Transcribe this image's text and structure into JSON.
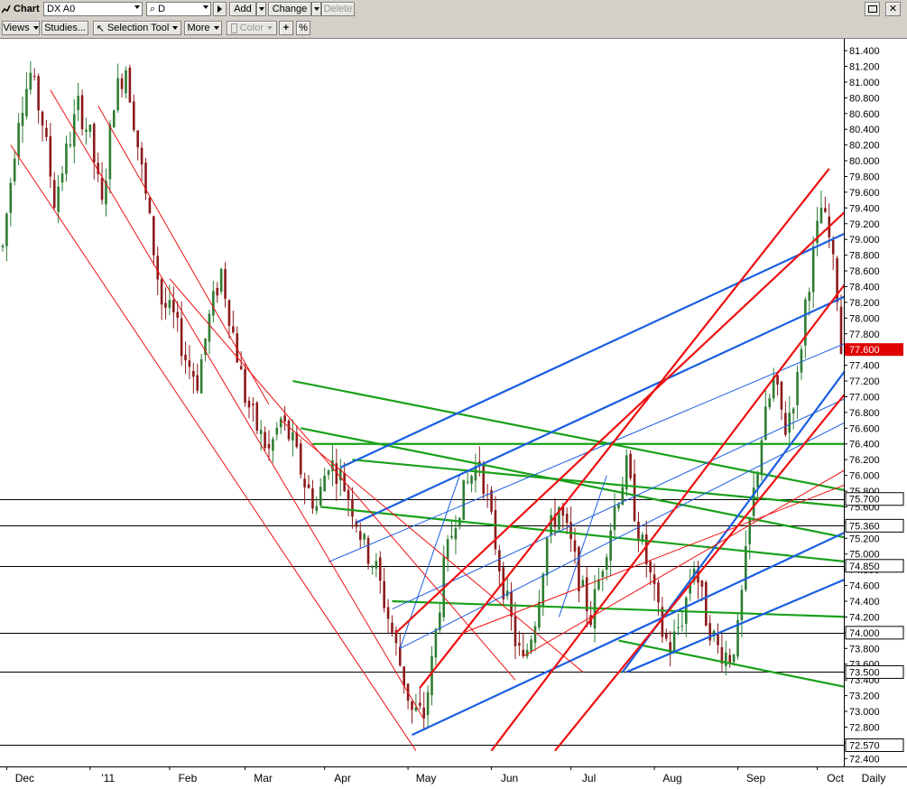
{
  "toolbar": {
    "chart_label": "Chart",
    "symbol_value": "DX A0",
    "period_value": "D",
    "add_label": "Add",
    "change_label": "Change",
    "delete_label": "Delete",
    "views_label": "Views",
    "studies_label": "Studies...",
    "selection_tool_label": "Selection Tool",
    "more_label": "More",
    "color_label": "Color",
    "crosshair_label": "+",
    "percent_label": "%"
  },
  "colors": {
    "up_candle": "#2e7d32",
    "down_candle": "#8b1a1a",
    "price_badge": "#e00000",
    "red_channel": "#ee1111",
    "blue_channel": "#1a5fe0",
    "green_channel": "#1aa01a",
    "black_level": "#000000"
  },
  "chart_data": {
    "type": "candlestick",
    "symbol": "DX A0",
    "interval": "Daily",
    "ylim": [
      72.3,
      81.55
    ],
    "y_ticks": [
      81.4,
      81.2,
      81.0,
      80.8,
      80.6,
      80.4,
      80.2,
      80.0,
      79.8,
      79.6,
      79.4,
      79.2,
      79.0,
      78.8,
      78.6,
      78.4,
      78.2,
      78.0,
      77.8,
      77.6,
      77.4,
      77.2,
      77.0,
      76.8,
      76.6,
      76.4,
      76.2,
      76.0,
      75.8,
      75.6,
      75.4,
      75.2,
      75.0,
      74.8,
      74.6,
      74.4,
      74.2,
      74.0,
      73.8,
      73.6,
      73.4,
      73.2,
      73.0,
      72.8,
      72.6,
      72.4
    ],
    "y_tick_labels": [
      "81.400",
      "81.200",
      "81.000",
      "80.800",
      "80.600",
      "80.400",
      "80.200",
      "80.000",
      "79.800",
      "79.600",
      "79.400",
      "79.200",
      "79.000",
      "78.800",
      "78.600",
      "78.400",
      "78.200",
      "78.000",
      "77.800",
      "77.600",
      "77.400",
      "77.200",
      "77.000",
      "76.800",
      "76.600",
      "76.400",
      "76.200",
      "76.000",
      "75.800",
      "75.600",
      "75.400",
      "75.200",
      "75.000",
      "74.800",
      "74.600",
      "74.400",
      "74.200",
      "74.000",
      "73.800",
      "73.600",
      "73.400",
      "73.200",
      "73.000",
      "72.800",
      "72.600",
      "72.400"
    ],
    "x_labels": [
      "Dec",
      "'11",
      "Feb",
      "Mar",
      "Apr",
      "May",
      "Jun",
      "Jul",
      "Aug",
      "Sep",
      "Oct"
    ],
    "x_label_positions": [
      1,
      22,
      42,
      61,
      81,
      102,
      123,
      143,
      164,
      185,
      205
    ],
    "num_bars": 212,
    "level_lines": [
      {
        "price": 75.7,
        "label": "75.700"
      },
      {
        "price": 75.36,
        "label": "75.360"
      },
      {
        "price": 74.85,
        "label": "74.850"
      },
      {
        "price": 74.0,
        "label": "74.000"
      },
      {
        "price": 73.5,
        "label": "73.500"
      },
      {
        "price": 72.57,
        "label": "72.570"
      }
    ],
    "last_price": 77.6,
    "last_price_label": "77.600",
    "close_path": [
      [
        0,
        78.9
      ],
      [
        4,
        80.6
      ],
      [
        7,
        81.1
      ],
      [
        10,
        80.5
      ],
      [
        13,
        79.5
      ],
      [
        16,
        80.1
      ],
      [
        19,
        80.7
      ],
      [
        22,
        80.3
      ],
      [
        25,
        79.4
      ],
      [
        28,
        80.8
      ],
      [
        31,
        81.2
      ],
      [
        34,
        80.2
      ],
      [
        37,
        79.2
      ],
      [
        40,
        78.2
      ],
      [
        43,
        78.0
      ],
      [
        46,
        77.5
      ],
      [
        49,
        77.2
      ],
      [
        52,
        78.0
      ],
      [
        55,
        78.6
      ],
      [
        58,
        77.8
      ],
      [
        61,
        77.0
      ],
      [
        64,
        76.6
      ],
      [
        67,
        76.3
      ],
      [
        70,
        76.7
      ],
      [
        73,
        76.4
      ],
      [
        76,
        75.9
      ],
      [
        79,
        75.6
      ],
      [
        82,
        76.2
      ],
      [
        85,
        76.0
      ],
      [
        88,
        75.6
      ],
      [
        91,
        75.1
      ],
      [
        94,
        74.8
      ],
      [
        97,
        74.2
      ],
      [
        100,
        73.6
      ],
      [
        103,
        73.0
      ],
      [
        106,
        72.95
      ],
      [
        108,
        73.6
      ],
      [
        111,
        74.8
      ],
      [
        114,
        75.5
      ],
      [
        117,
        75.9
      ],
      [
        120,
        76.2
      ],
      [
        123,
        75.4
      ],
      [
        126,
        74.6
      ],
      [
        129,
        73.9
      ],
      [
        131,
        73.6
      ],
      [
        134,
        74.2
      ],
      [
        137,
        75.2
      ],
      [
        140,
        75.6
      ],
      [
        143,
        75.1
      ],
      [
        146,
        74.5
      ],
      [
        148,
        74.2
      ],
      [
        151,
        74.9
      ],
      [
        154,
        75.6
      ],
      [
        157,
        76.1
      ],
      [
        160,
        75.3
      ],
      [
        163,
        74.7
      ],
      [
        166,
        74.0
      ],
      [
        168,
        73.8
      ],
      [
        171,
        74.2
      ],
      [
        174,
        74.9
      ],
      [
        177,
        74.2
      ],
      [
        180,
        73.8
      ],
      [
        183,
        73.7
      ],
      [
        185,
        74.0
      ],
      [
        188,
        75.4
      ],
      [
        191,
        76.5
      ],
      [
        194,
        77.2
      ],
      [
        197,
        76.6
      ],
      [
        200,
        77.2
      ],
      [
        202,
        78.2
      ],
      [
        204,
        78.8
      ],
      [
        206,
        79.4
      ],
      [
        208,
        79.0
      ],
      [
        210,
        78.3
      ],
      [
        211,
        77.6
      ]
    ],
    "drawn_lines": {
      "red": [
        {
          "p1": [
            2,
            80.2
          ],
          "p2": [
            104,
            72.5
          ],
          "w": 1
        },
        {
          "p1": [
            24,
            80.7
          ],
          "p2": [
            67,
            76.9
          ],
          "w": 1
        },
        {
          "p1": [
            12,
            80.9
          ],
          "p2": [
            106,
            72.9
          ],
          "w": 1
        },
        {
          "p1": [
            42,
            78.5
          ],
          "p2": [
            129,
            73.4
          ],
          "w": 1
        },
        {
          "p1": [
            70,
            76.7
          ],
          "p2": [
            146,
            73.5
          ],
          "w": 1
        },
        {
          "p1": [
            99,
            74.0
          ],
          "p2": [
            213,
            79.4
          ],
          "w": 2
        },
        {
          "p1": [
            123,
            72.5
          ],
          "p2": [
            213,
            78.5
          ],
          "w": 2
        },
        {
          "p1": [
            139,
            72.5
          ],
          "p2": [
            213,
            77.1
          ],
          "w": 2
        },
        {
          "p1": [
            105,
            73.3
          ],
          "p2": [
            208,
            79.9
          ],
          "w": 2
        },
        {
          "p1": [
            116,
            74.0
          ],
          "p2": [
            213,
            75.9
          ],
          "w": 1
        },
        {
          "p1": [
            131,
            73.7
          ],
          "p2": [
            213,
            76.1
          ],
          "w": 1
        }
      ],
      "blue": [
        {
          "p1": [
            85,
            76.1
          ],
          "p2": [
            213,
            79.1
          ],
          "w": 2
        },
        {
          "p1": [
            103,
            72.7
          ],
          "p2": [
            213,
            75.3
          ],
          "w": 2
        },
        {
          "p1": [
            89,
            75.4
          ],
          "p2": [
            213,
            78.3
          ],
          "w": 2
        },
        {
          "p1": [
            157,
            73.5
          ],
          "p2": [
            213,
            74.7
          ],
          "w": 2
        },
        {
          "p1": [
            156,
            73.5
          ],
          "p2": [
            213,
            77.4
          ],
          "w": 2
        },
        {
          "p1": [
            82,
            74.9
          ],
          "p2": [
            213,
            77.7
          ],
          "w": 1
        },
        {
          "p1": [
            98,
            74.3
          ],
          "p2": [
            213,
            77.0
          ],
          "w": 1
        },
        {
          "p1": [
            100,
            73.8
          ],
          "p2": [
            213,
            76.7
          ],
          "w": 1
        },
        {
          "p1": [
            100,
            73.8
          ],
          "p2": [
            115,
            76.0
          ],
          "w": 1
        },
        {
          "p1": [
            140,
            74.2
          ],
          "p2": [
            152,
            76.0
          ],
          "w": 1
        }
      ],
      "green": [
        {
          "p1": [
            73,
            77.2
          ],
          "p2": [
            213,
            75.8
          ],
          "w": 2
        },
        {
          "p1": [
            75,
            76.6
          ],
          "p2": [
            213,
            75.2
          ],
          "w": 2
        },
        {
          "p1": [
            80,
            75.6
          ],
          "p2": [
            213,
            74.9
          ],
          "w": 2
        },
        {
          "p1": [
            88,
            76.2
          ],
          "p2": [
            213,
            75.6
          ],
          "w": 2
        },
        {
          "p1": [
            98,
            74.4
          ],
          "p2": [
            213,
            74.2
          ],
          "w": 2
        },
        {
          "p1": [
            155,
            73.9
          ],
          "p2": [
            213,
            73.3
          ],
          "w": 2
        },
        {
          "p1": [
            78,
            76.4
          ],
          "p2": [
            213,
            76.4
          ],
          "w": 2
        }
      ]
    }
  }
}
